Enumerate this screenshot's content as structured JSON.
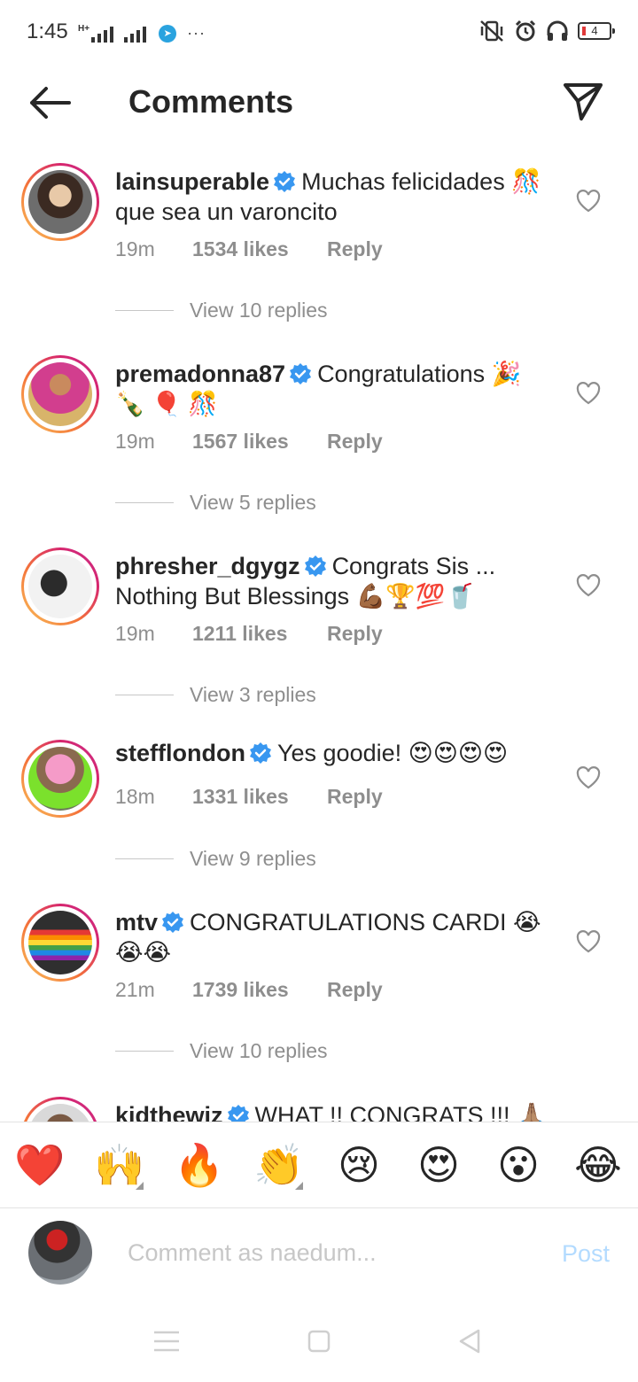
{
  "status_bar": {
    "time": "1:45",
    "signal_label": "H+",
    "battery_level": "4"
  },
  "header": {
    "title": "Comments"
  },
  "comments": [
    {
      "username": "lainsuperable",
      "text": "Muchas felicidades 🎊 que sea un varoncito",
      "time": "19m",
      "likes": "1534 likes",
      "reply": "Reply",
      "view_replies": "View 10 replies"
    },
    {
      "username": "premadonna87",
      "text": "Congratulations 🎉 🍾 🎈 🎊",
      "time": "19m",
      "likes": "1567 likes",
      "reply": "Reply",
      "view_replies": "View 5 replies"
    },
    {
      "username": "phresher_dgygz",
      "text": "Congrats Sis ... Nothing But Blessings 💪🏾🏆💯🥤",
      "time": "19m",
      "likes": "1211 likes",
      "reply": "Reply",
      "view_replies": "View 3 replies"
    },
    {
      "username": "stefflondon",
      "text": "Yes goodie! 😍😍😍😍",
      "time": "18m",
      "likes": "1331 likes",
      "reply": "Reply",
      "view_replies": "View 9 replies"
    },
    {
      "username": "mtv",
      "text": "CONGRATULATIONS CARDI 😭😭😭",
      "time": "21m",
      "likes": "1739 likes",
      "reply": "Reply",
      "view_replies": "View 10 replies"
    },
    {
      "username": "kidthewiz",
      "text": "WHAT !! CONGRATS !!! 🙏🏽"
    }
  ],
  "emoji_bar": [
    "❤️",
    "🙌",
    "🔥",
    "👏",
    "😢",
    "😍",
    "😮",
    "😂"
  ],
  "composer": {
    "placeholder": "Comment as naedum...",
    "post_label": "Post"
  },
  "colors": {
    "accent_blue": "#3897f0",
    "post_disabled": "#b3dbff",
    "muted_text": "#8e8e8e",
    "like_heart": "#8e8e8e"
  }
}
